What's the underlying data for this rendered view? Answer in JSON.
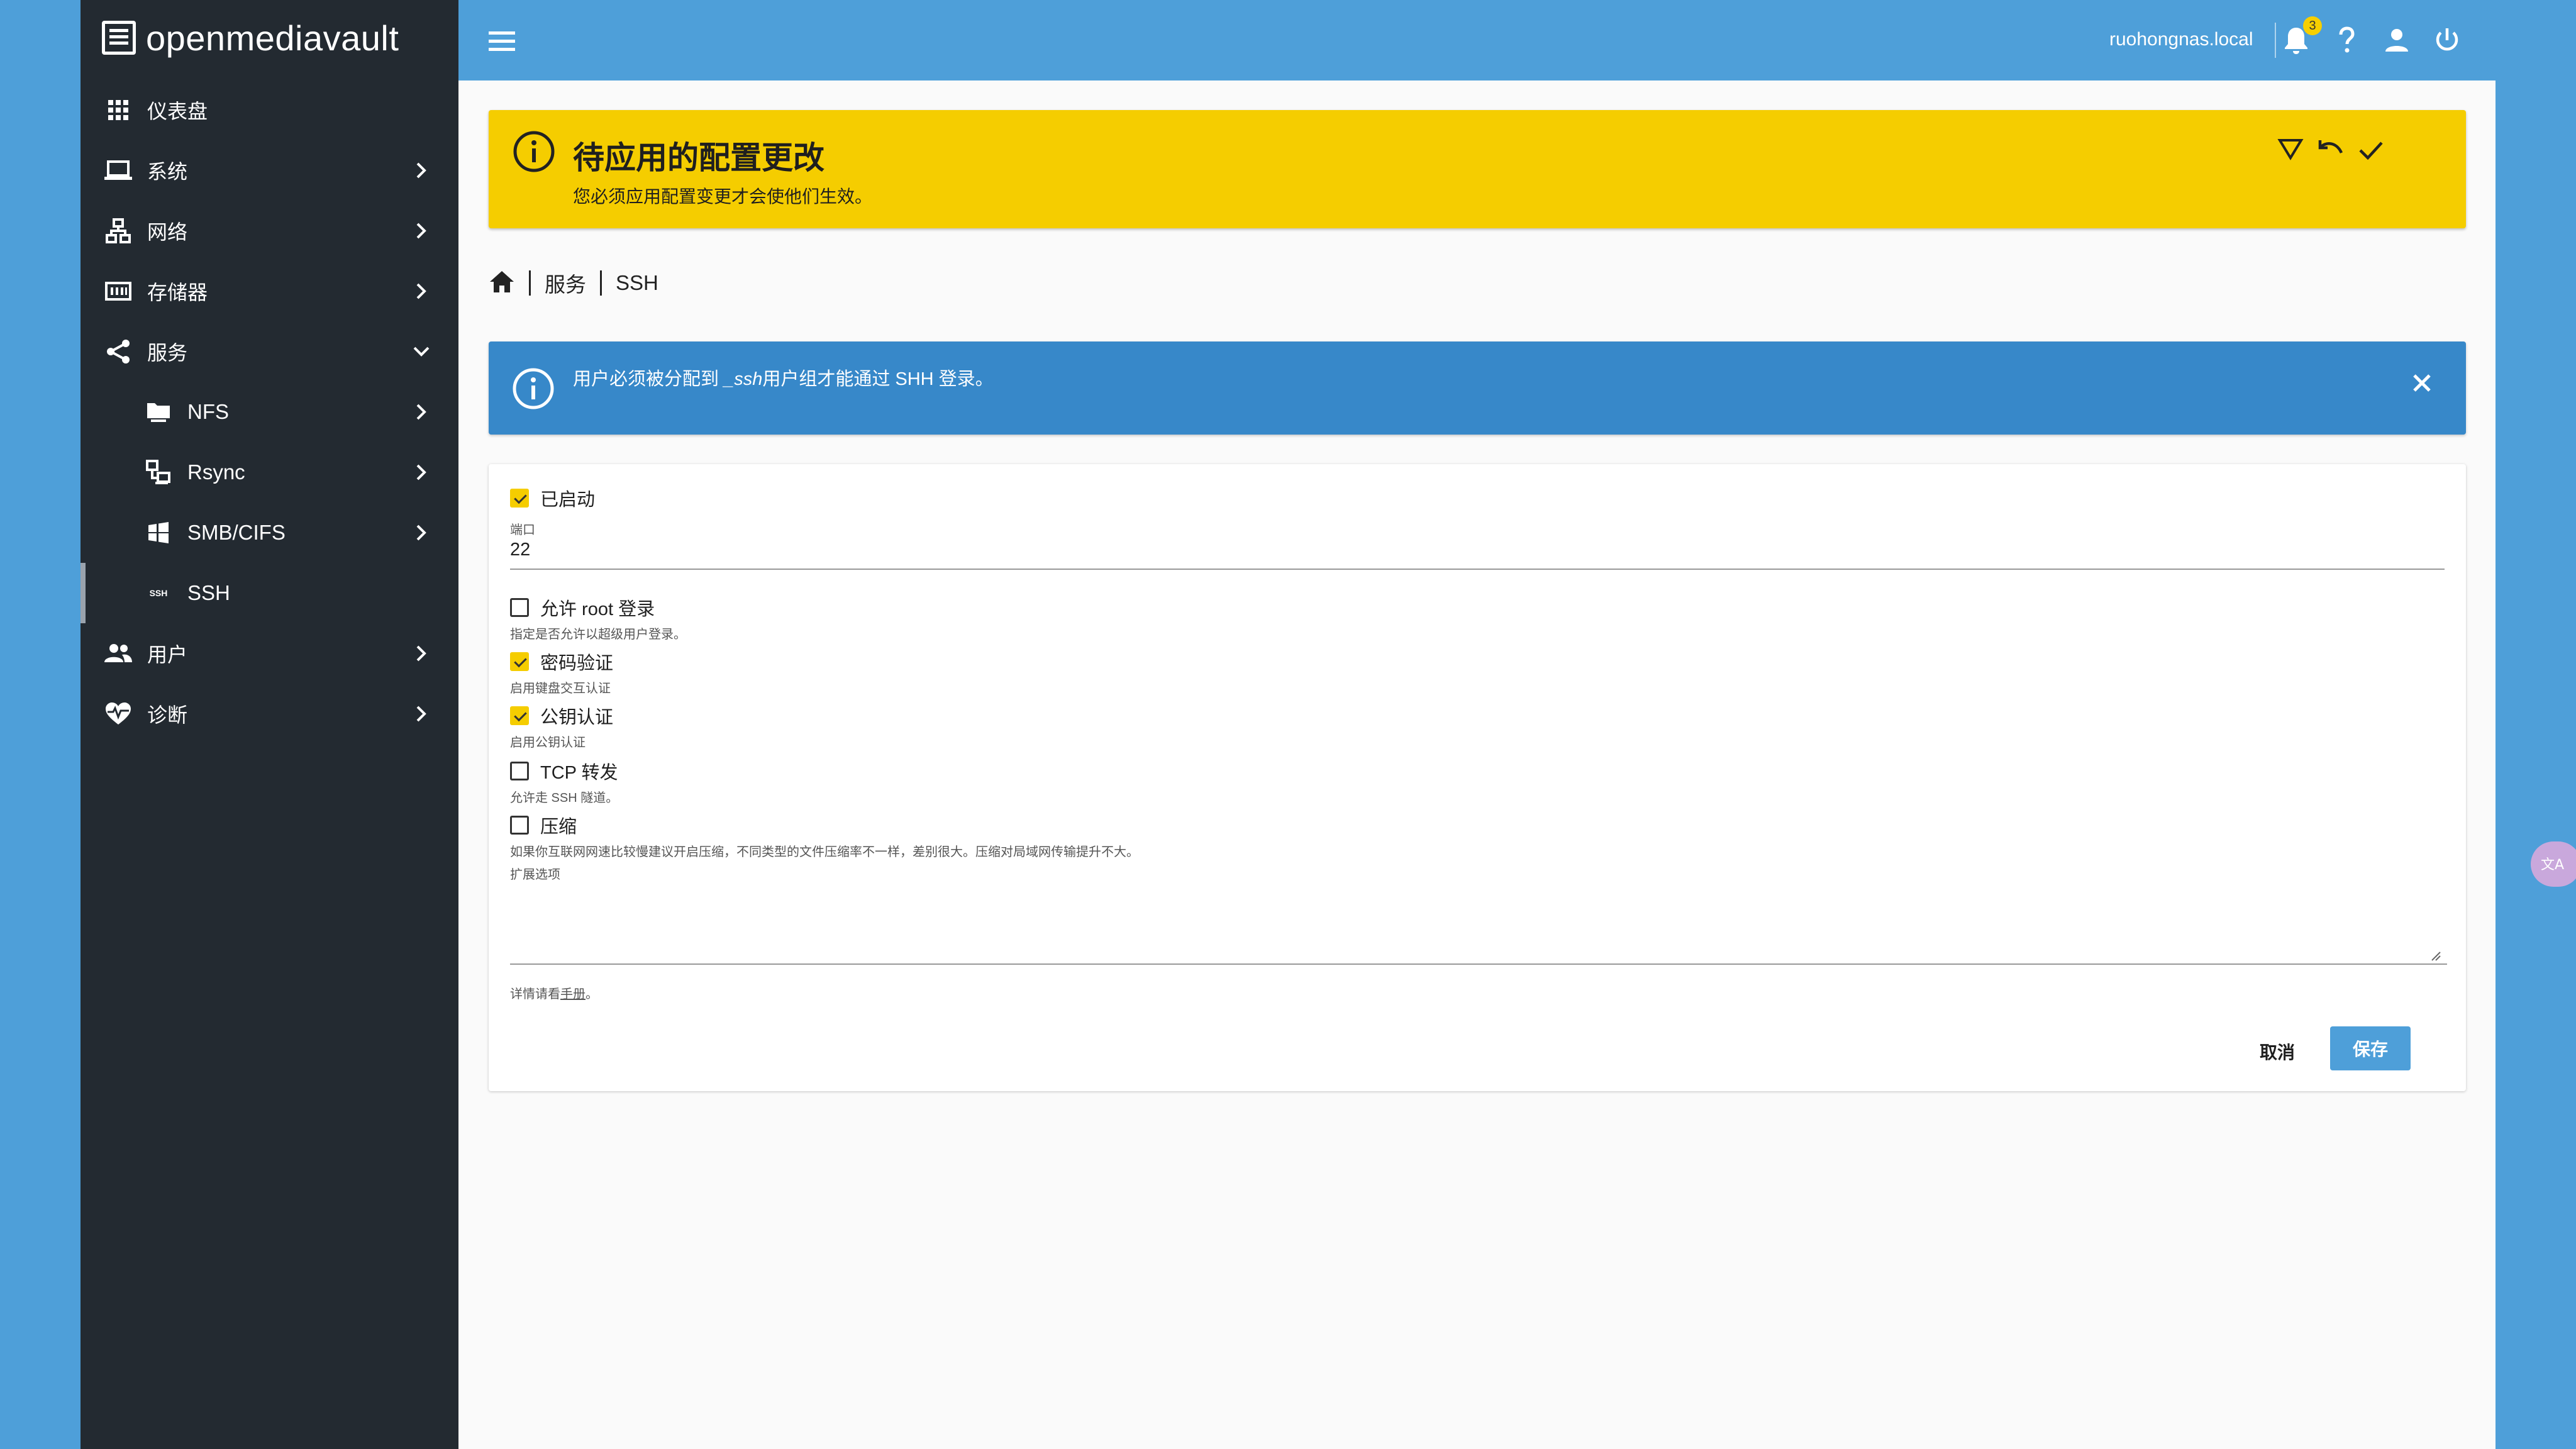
{
  "app": {
    "logo_text": "openmediavault"
  },
  "sidebar": {
    "items": [
      {
        "label": "仪表盘",
        "icon": "dashboard-grid-icon"
      },
      {
        "label": "系统",
        "icon": "laptop-icon"
      },
      {
        "label": "网络",
        "icon": "network-icon"
      },
      {
        "label": "存储器",
        "icon": "storage-icon"
      },
      {
        "label": "服务",
        "icon": "share-icon",
        "expanded": true
      },
      {
        "label": "NFS",
        "icon": "nfs-folder-icon"
      },
      {
        "label": "Rsync",
        "icon": "rsync-icon"
      },
      {
        "label": "SMB/CIFS",
        "icon": "windows-icon"
      },
      {
        "label": "SSH",
        "icon": "ssh-icon",
        "active": true
      },
      {
        "label": "用户",
        "icon": "users-icon"
      },
      {
        "label": "诊断",
        "icon": "heart-pulse-icon"
      }
    ],
    "ssh_badge": "SSH"
  },
  "topbar": {
    "hostname": "ruohongnas.local",
    "notification_count": "3"
  },
  "pending": {
    "title": "待应用的配置更改",
    "subtitle": "您必须应用配置变更才会使他们生效。"
  },
  "breadcrumb": {
    "items": [
      "服务",
      "SSH"
    ]
  },
  "info": {
    "message_prefix": "用户必须被分配到 ",
    "message_em": "_ssh",
    "message_suffix": "用户组才能通过 SHH 登录。"
  },
  "form": {
    "enabled_label": "已启动",
    "enabled": true,
    "port_label": "端口",
    "port_value": "22",
    "permit_root_label": "允许 root 登录",
    "permit_root": false,
    "permit_root_hint": "指定是否允许以超级用户登录。",
    "password_auth_label": "密码验证",
    "password_auth": true,
    "password_auth_hint": "启用键盘交互认证",
    "pubkey_auth_label": "公钥认证",
    "pubkey_auth": true,
    "pubkey_auth_hint": "启用公钥认证",
    "tcp_forward_label": "TCP 转发",
    "tcp_forward": false,
    "tcp_forward_hint": "允许走 SSH 隧道。",
    "compression_label": "压缩",
    "compression": false,
    "compression_hint": "如果你互联网网速比较慢建议开启压缩，不同类型的文件压缩率不一样，差别很大。压缩对局域网传输提升不大。",
    "extra_options_label": "扩展选项",
    "extra_options_value": "",
    "manual_hint_prefix": "详情请看",
    "manual_link": "手册",
    "manual_hint_suffix": "。",
    "cancel_label": "取消",
    "save_label": "保存"
  },
  "colors": {
    "topbar": "#4e9fd9",
    "sidebar": "#232a31",
    "pending_banner": "#f5cd00",
    "info_banner": "#3788c9"
  }
}
